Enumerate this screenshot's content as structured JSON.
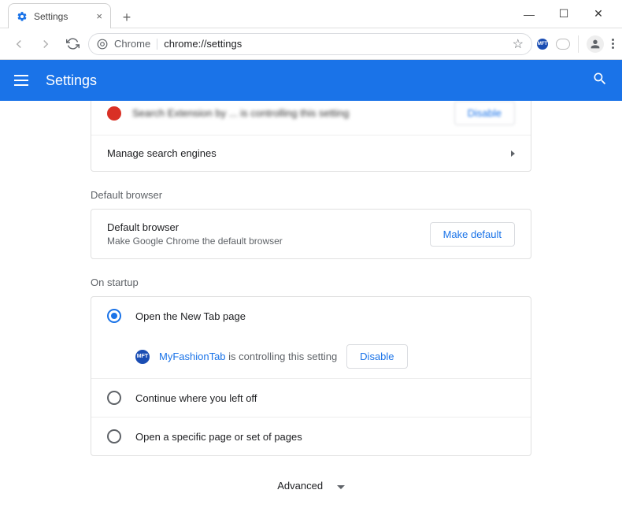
{
  "window": {
    "tab_title": "Settings",
    "newtab_glyph": "+",
    "close_glyph": "×",
    "min_glyph": "—",
    "max_glyph": "☐",
    "win_close_glyph": "✕"
  },
  "omnibox": {
    "scheme_label": "Chrome",
    "url": "chrome://settings",
    "star_glyph": "☆"
  },
  "ext_icon": {
    "label": "MFT"
  },
  "header": {
    "title": "Settings"
  },
  "search_engines": {
    "partial_blurred": "Search Extension by ... is controlling this setting",
    "partial_button": "Disable",
    "manage_label": "Manage search engines"
  },
  "default_browser": {
    "section_label": "Default browser",
    "row_title": "Default browser",
    "row_subtitle": "Make Google Chrome the default browser",
    "button_label": "Make default"
  },
  "startup": {
    "section_label": "On startup",
    "options": [
      {
        "label": "Open the New Tab page",
        "checked": true
      },
      {
        "label": "Continue where you left off",
        "checked": false
      },
      {
        "label": "Open a specific page or set of pages",
        "checked": false
      }
    ],
    "controlled_by": {
      "icon_label": "MFT",
      "extension_name": "MyFashionTab",
      "suffix_text": " is controlling this setting",
      "button_label": "Disable"
    }
  },
  "advanced": {
    "label": "Advanced"
  }
}
